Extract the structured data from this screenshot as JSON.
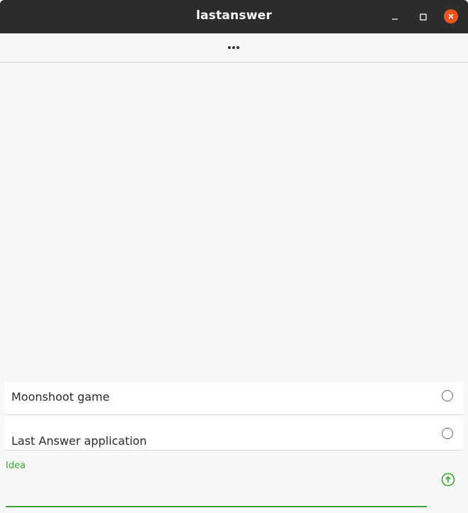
{
  "window": {
    "title": "lastanswer"
  },
  "titlebar_buttons": {
    "minimize_icon": "minimize-icon",
    "maximize_icon": "maximize-icon",
    "close_icon": "close-icon",
    "close_color": "#e9541f"
  },
  "toolbar": {
    "more_icon": "more-horizontal-icon"
  },
  "list": {
    "items": [
      {
        "label": "Moonshoot game",
        "checked": false
      },
      {
        "label": "Last Answer application",
        "checked": false
      }
    ]
  },
  "input": {
    "label": "Idea",
    "value": "",
    "accent_color": "#3aaa35",
    "submit_icon": "arrow-up-circle-icon"
  }
}
